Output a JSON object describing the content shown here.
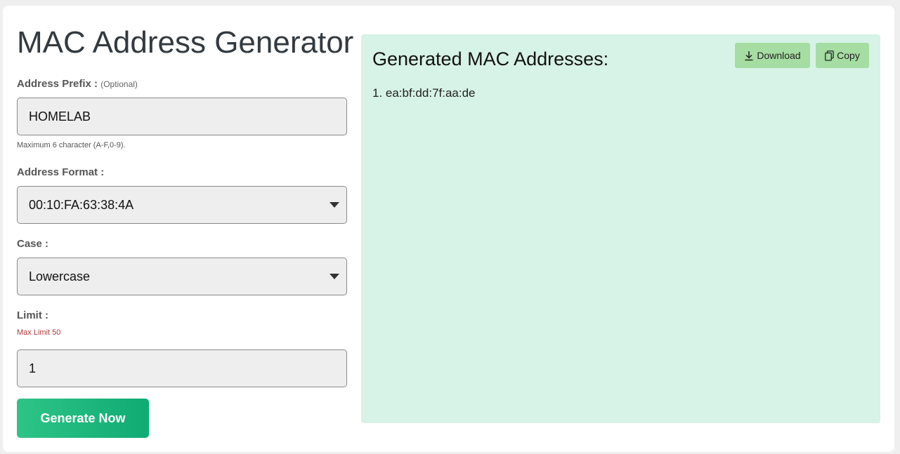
{
  "page": {
    "title": "MAC Address Generator"
  },
  "form": {
    "prefix": {
      "label": "Address Prefix :",
      "optional": "(Optional)",
      "value": "HOMELAB",
      "hint": "Maximum 6 character (A-F,0-9)."
    },
    "format": {
      "label": "Address Format :",
      "selected": "00:10:FA:63:38:4A"
    },
    "case": {
      "label": "Case :",
      "selected": "Lowercase"
    },
    "limit": {
      "label": "Limit :",
      "hint": "Max Limit 50",
      "value": "1"
    },
    "generate_label": "Generate Now"
  },
  "results": {
    "title": "Generated MAC Addresses:",
    "download_label": "Download",
    "copy_label": "Copy",
    "items": [
      "1. ea:bf:dd:7f:aa:de"
    ]
  },
  "colors": {
    "accent": "#0fab73",
    "panel_bg": "#d7f2e6",
    "small_button_bg": "#a6dda2"
  }
}
